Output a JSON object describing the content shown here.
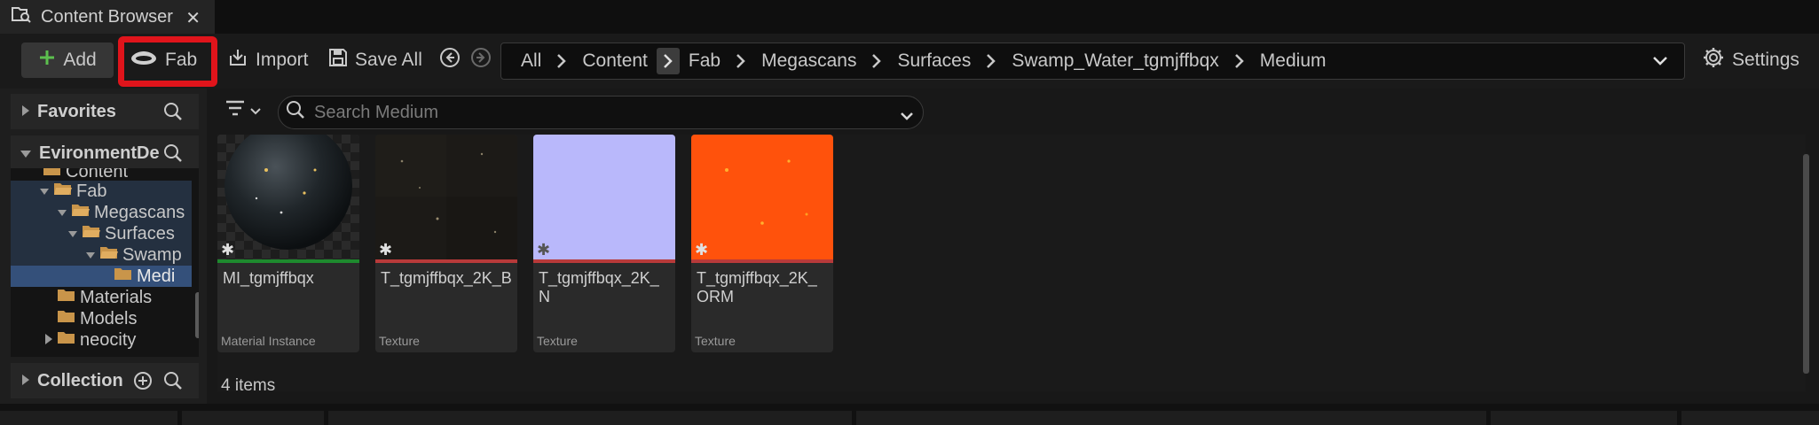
{
  "window": {
    "tab_title": "Content Browser",
    "close_glyph": "✕"
  },
  "toolbar": {
    "add_label": "Add",
    "fab_label": "Fab",
    "import_label": "Import",
    "save_all_label": "Save All",
    "settings_label": "Settings",
    "highlight_color": "#e0141b"
  },
  "breadcrumb": {
    "items": [
      "All",
      "Content",
      "Fab",
      "Megascans",
      "Surfaces",
      "Swamp_Water_tgmjffbqx",
      "Medium"
    ]
  },
  "sidebar": {
    "favorites_label": "Favorites",
    "project_label": "EvironmentDe",
    "collections_label": "Collection",
    "tree": [
      {
        "label": "Content"
      },
      {
        "label": "Fab"
      },
      {
        "label": "Megascans"
      },
      {
        "label": "Surfaces"
      },
      {
        "label": "Swamp"
      },
      {
        "label": "Medi"
      },
      {
        "label": "Materials"
      },
      {
        "label": "Models"
      },
      {
        "label": "neocity"
      }
    ]
  },
  "search": {
    "placeholder": "Search Medium"
  },
  "assets": [
    {
      "name": "MI_tgmjffbqx",
      "type": "Material Instance",
      "bar_color": "#1e8a2e"
    },
    {
      "name": "T_tgmjffbqx_2K_B",
      "type": "Texture",
      "bar_color": "#b83a3a"
    },
    {
      "name": "T_tgmjffbqx_2K_N",
      "type": "Texture",
      "bar_color": "#b83a3a"
    },
    {
      "name": "T_tgmjffbqx_2K_ ORM",
      "type": "Texture",
      "bar_color": "#b83a3a"
    }
  ],
  "status": {
    "item_count": "4 items"
  },
  "colors": {
    "add_icon": "#5cc04e",
    "normal_map": "#b9b8fb",
    "orm_map": "#ff5a10",
    "folder": "#c9954a"
  }
}
